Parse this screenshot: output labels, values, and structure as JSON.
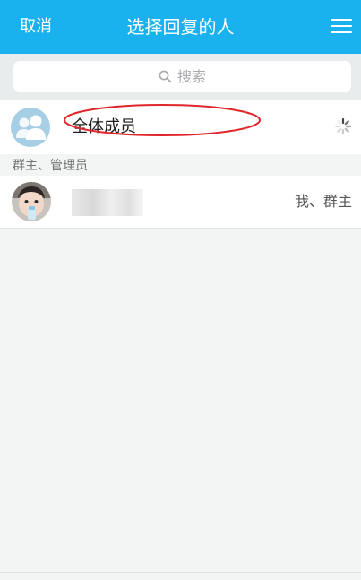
{
  "header": {
    "cancel_label": "取消",
    "title": "选择回复的人"
  },
  "search": {
    "placeholder": "搜索"
  },
  "all_members": {
    "label": "全体成员"
  },
  "section": {
    "title": "群主、管理员"
  },
  "members": [
    {
      "role": "我、群主"
    }
  ],
  "colors": {
    "accent": "#19b2ee",
    "annotation": "#e0262b"
  },
  "icons": [
    "menu-icon",
    "search-icon",
    "group-avatar-icon",
    "loading-spinner-icon",
    "user-avatar"
  ]
}
